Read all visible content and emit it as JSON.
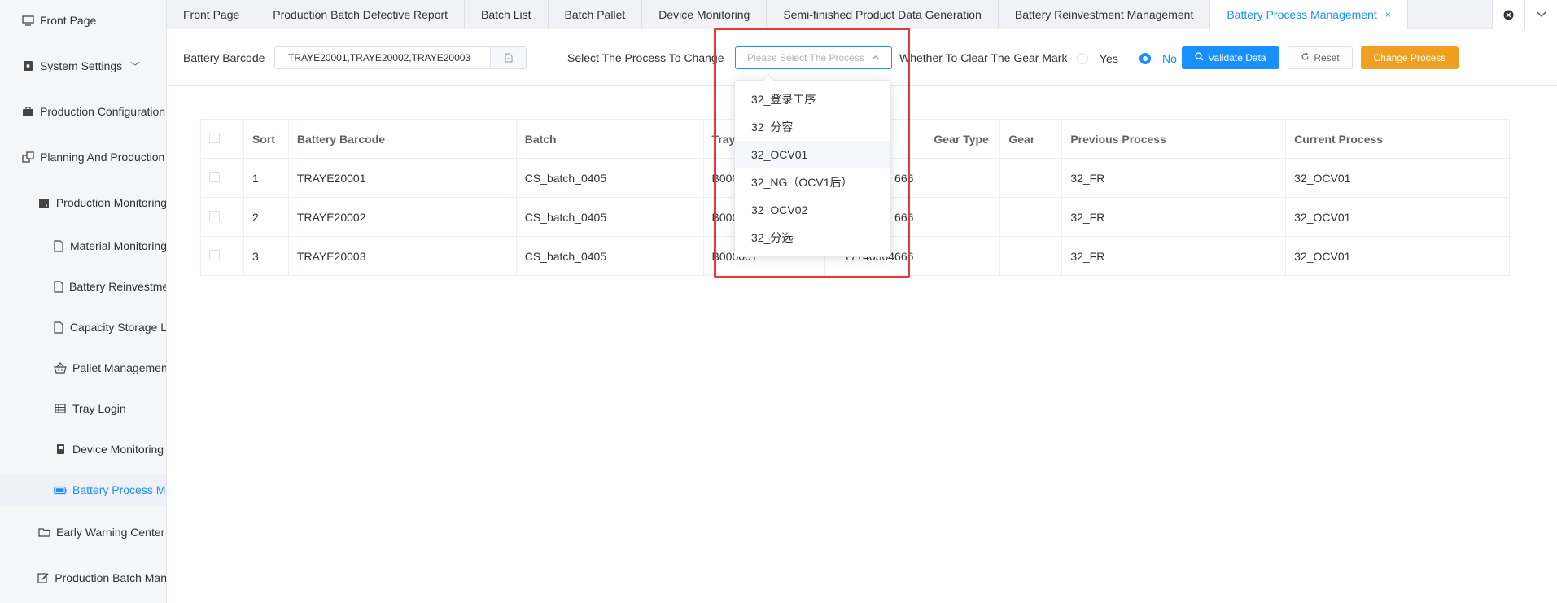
{
  "sidebar": {
    "items": [
      {
        "label": "Front Page",
        "icon": "monitor-icon"
      },
      {
        "label": "System Settings",
        "icon": "settings-box-icon"
      },
      {
        "label": "Production Configuration",
        "icon": "briefcase-icon"
      },
      {
        "label": "Planning And Production",
        "icon": "windows-icon"
      },
      {
        "label": "Production Monitoring",
        "icon": "server-icon"
      },
      {
        "label": "Material Monitoring",
        "icon": "document-icon"
      },
      {
        "label": "Battery Reinvestment",
        "icon": "document-icon"
      },
      {
        "label": "Capacity Storage L",
        "icon": "document-icon"
      },
      {
        "label": "Pallet Management",
        "icon": "basket-icon"
      },
      {
        "label": "Tray Login",
        "icon": "grid-icon"
      },
      {
        "label": "Device Monitoring",
        "icon": "device-icon"
      },
      {
        "label": "Battery Process M",
        "icon": "battery-icon"
      },
      {
        "label": "Early Warning Center",
        "icon": "folder-icon"
      },
      {
        "label": "Production Batch Man",
        "icon": "edit-icon"
      }
    ]
  },
  "tabs": [
    {
      "label": "Front Page"
    },
    {
      "label": "Production Batch Defective Report"
    },
    {
      "label": "Batch List"
    },
    {
      "label": "Batch Pallet"
    },
    {
      "label": "Device Monitoring"
    },
    {
      "label": "Semi-finished Product Data Generation"
    },
    {
      "label": "Battery Reinvestment Management"
    },
    {
      "label": "Battery Process Management",
      "close": "×"
    }
  ],
  "toolbar": {
    "barcode_label": "Battery Barcode",
    "barcode_value": "TRAYE20001,TRAYE20002,TRAYE20003",
    "process_label": "Select The Process To Change",
    "process_placeholder": "Please Select The Process",
    "clear_label": "Whether To Clear The Gear Mark",
    "yes_label": "Yes",
    "no_label": "No",
    "validate_label": "Validate Data",
    "reset_label": "Reset",
    "change_label": "Change Process"
  },
  "table": {
    "headers": [
      "Sort",
      "Battery Barcode",
      "Batch",
      "Tray",
      "",
      "Gear Type",
      "Gear",
      "Previous Process",
      "Current Process"
    ],
    "rows": [
      {
        "sort": "1",
        "barcode": "TRAYE20001",
        "batch": "CS_batch_0405",
        "tray": "B000",
        "col5": "666",
        "gear_type": "",
        "gear": "",
        "previous": "32_FR",
        "current": "32_OCV01"
      },
      {
        "sort": "2",
        "barcode": "TRAYE20002",
        "batch": "CS_batch_0405",
        "tray": "B000",
        "col5": "666",
        "gear_type": "",
        "gear": "",
        "previous": "32_FR",
        "current": "32_OCV01"
      },
      {
        "sort": "3",
        "barcode": "TRAYE20003",
        "batch": "CS_batch_0405",
        "tray": "B000001",
        "col5": "17746304666",
        "gear_type": "",
        "gear": "",
        "previous": "32_FR",
        "current": "32_OCV01"
      }
    ]
  },
  "dropdown": {
    "options": [
      "32_登录工序",
      "32_分容",
      "32_OCV01",
      "32_NG（OCV1后）",
      "32_OCV02",
      "32_分选"
    ]
  },
  "colors": {
    "accent": "#1890ff",
    "warning": "#f0a020",
    "highlight": "#e53935"
  }
}
